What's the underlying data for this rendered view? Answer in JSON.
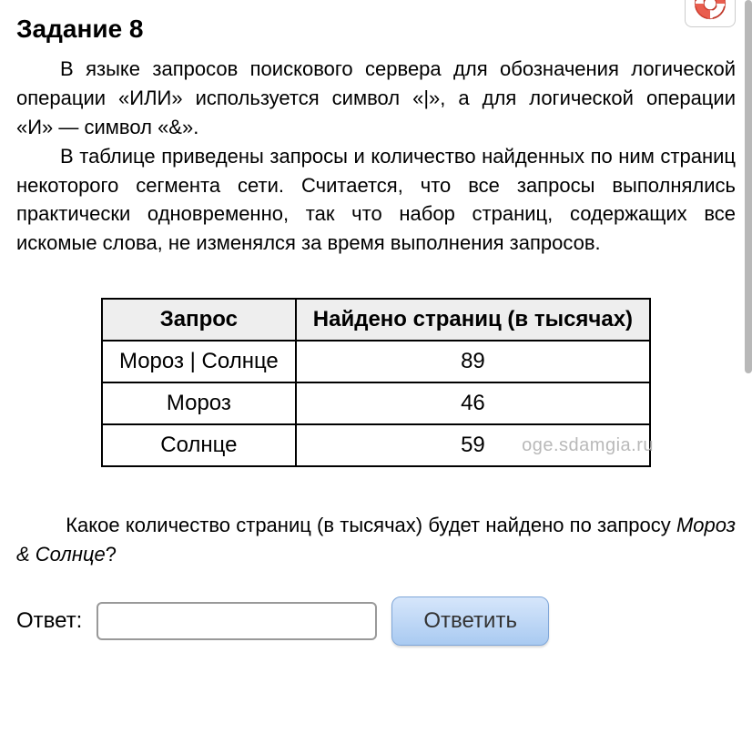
{
  "task_title": "Задание 8",
  "paragraph1": "В языке запросов поискового сервера для обозначения логической операции «ИЛИ» используется символ «|», а для логической операции «И» — символ «&».",
  "paragraph2": "В таблице приведены запросы и количество найденных по ним страниц некоторого сегмента сети. Считается, что все запросы выполнялись практически одновременно, так что набор страниц, содержащих все искомые слова, не изменялся за время выполнения запросов.",
  "table": {
    "headers": [
      "Запрос",
      "Найдено страниц (в тысячах)"
    ],
    "rows": [
      [
        "Мороз | Солнце",
        "89"
      ],
      [
        "Мороз",
        "46"
      ],
      [
        "Солнце",
        "59"
      ]
    ]
  },
  "watermark": "oge.sdamgia.ru",
  "question_prefix": "Какое количество страниц (в тысячах) будет найдено по запросу ",
  "question_italic": "Мороз & Солнце",
  "question_suffix": "?",
  "answer_label": "Ответ:",
  "answer_button": "Ответить"
}
